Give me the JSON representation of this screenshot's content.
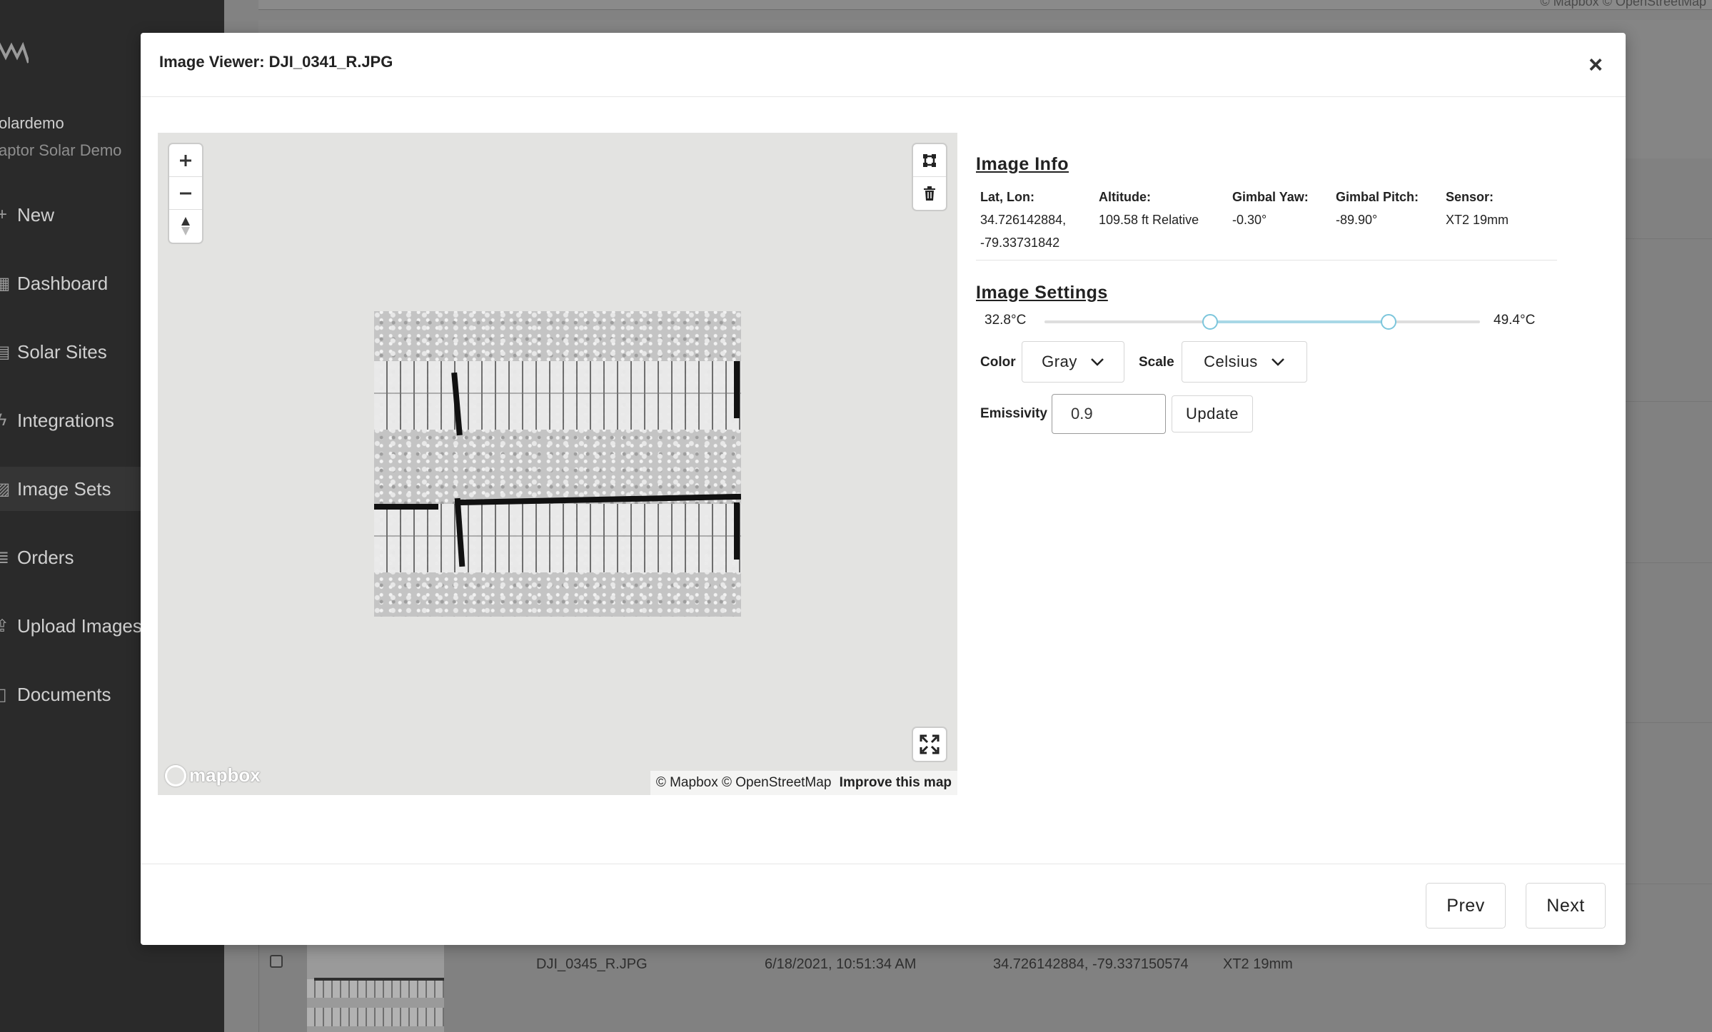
{
  "sidebar": {
    "user_name": "olardemo",
    "org_name": "aptor Solar Demo",
    "items": [
      {
        "label": "New",
        "icon": "plus-icon"
      },
      {
        "label": "Dashboard",
        "icon": "dashboard-icon"
      },
      {
        "label": "Solar Sites",
        "icon": "solar-panel-icon"
      },
      {
        "label": "Integrations",
        "icon": "lightning-icon"
      },
      {
        "label": "Image Sets",
        "icon": "image-icon",
        "active": true
      },
      {
        "label": "Orders",
        "icon": "receipt-icon"
      },
      {
        "label": "Upload Images",
        "icon": "upload-icon"
      },
      {
        "label": "Documents",
        "icon": "document-icon"
      }
    ]
  },
  "background": {
    "map_attribution": "© Mapbox © OpenStreetMap",
    "row": {
      "filename": "DJI_0345_R.JPG",
      "timestamp": "6/18/2021, 10:51:34 AM",
      "coords": "34.726142884, -79.337150574",
      "sensor": "XT2 19mm"
    }
  },
  "modal": {
    "title": "Image Viewer: DJI_0341_R.JPG",
    "close_label": "×",
    "map": {
      "logo_text": "mapbox",
      "attribution": "© Mapbox © OpenStreetMap",
      "improve_link": "Improve this map"
    },
    "image_info": {
      "title": "Image Info",
      "lat_lon_label": "Lat, Lon:",
      "lat": "34.726142884,",
      "lon": "-79.33731842",
      "altitude_label": "Altitude:",
      "altitude": "109.58 ft Relative",
      "gimbal_yaw_label": "Gimbal Yaw:",
      "gimbal_yaw": "-0.30°",
      "gimbal_pitch_label": "Gimbal Pitch:",
      "gimbal_pitch": "-89.90°",
      "sensor_label": "Sensor:",
      "sensor": "XT2 19mm"
    },
    "image_settings": {
      "title": "Image Settings",
      "min_temp": "32.8°C",
      "max_temp": "49.4°C",
      "slider_low_fraction": 0.38,
      "slider_high_fraction": 0.79,
      "color_label": "Color",
      "color_value": "Gray",
      "scale_label": "Scale",
      "scale_value": "Celsius",
      "emissivity_label": "Emissivity",
      "emissivity_value": "0.9",
      "update_label": "Update"
    },
    "footer": {
      "prev_label": "Prev",
      "next_label": "Next"
    }
  }
}
